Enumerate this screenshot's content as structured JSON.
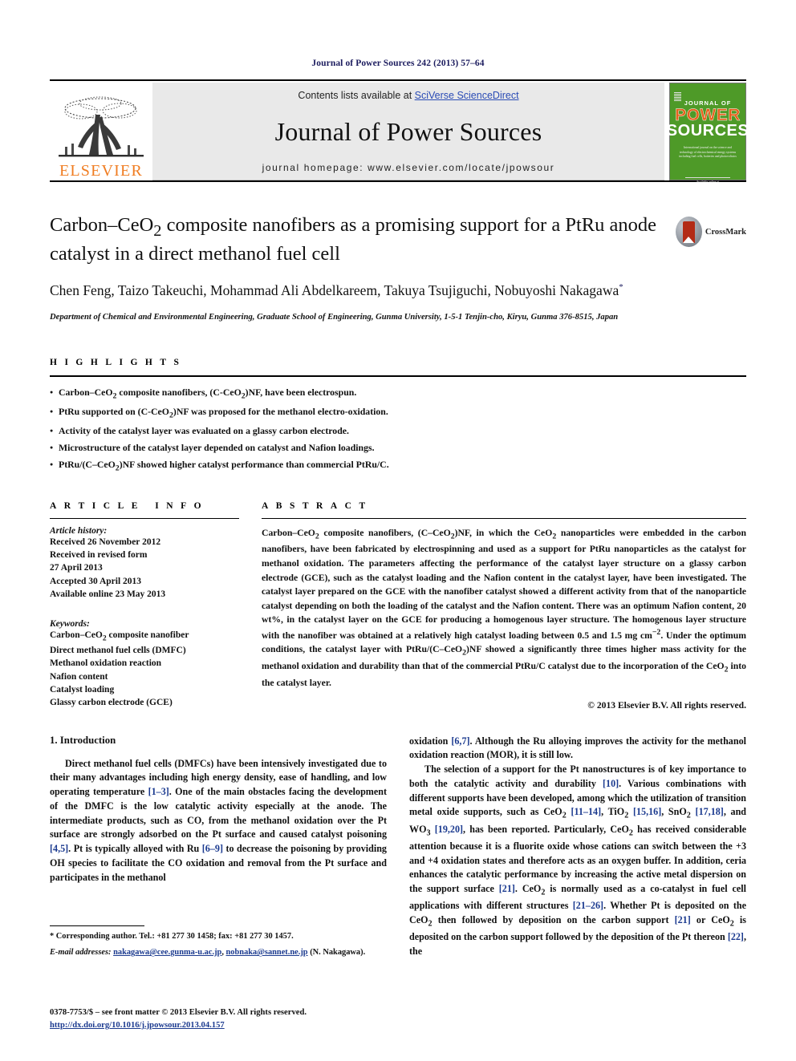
{
  "running_head": "Journal of Power Sources 242 (2013) 57–64",
  "masthead": {
    "elsevier_wordmark": "ELSEVIER",
    "contents_prefix": "Contents lists available at ",
    "contents_link": "SciVerse ScienceDirect",
    "journal_name": "Journal of Power Sources",
    "homepage": "journal homepage: www.elsevier.com/locate/jpowsour",
    "cover": {
      "line1": "JOURNAL OF",
      "line2": "POWER",
      "line3": "SOURCES",
      "blurb": "International journal on the science and technology of electrochemical energy systems including fuel cells, batteries and photovoltaics",
      "footer": "Available online at"
    }
  },
  "article": {
    "title": "Carbon–CeO2 composite nanofibers as a promising support for a PtRu anode catalyst in a direct methanol fuel cell",
    "title_part1": "Carbon–CeO",
    "title_sub": "2",
    "title_part2": " composite nanofibers as a promising support for a PtRu anode catalyst in a direct methanol fuel cell",
    "crossmark_label": "CrossMark",
    "authors": "Chen Feng, Taizo Takeuchi, Mohammad Ali Abdelkareem, Takuya Tsujiguchi, Nobuyoshi Nakagawa",
    "author_marker": "*",
    "affiliation": "Department of Chemical and Environmental Engineering, Graduate School of Engineering, Gunma University, 1-5-1 Tenjin-cho, Kiryu, Gunma 376-8515, Japan"
  },
  "highlights": {
    "label": "HIGHLIGHTS",
    "items": [
      "Carbon–CeO2 composite nanofibers, (C-CeO2)NF, have been electrospun.",
      "PtRu supported on (C-CeO2)NF was proposed for the methanol electro-oxidation.",
      "Activity of the catalyst layer was evaluated on a glassy carbon electrode.",
      "Microstructure of the catalyst layer depended on catalyst and Nafion loadings.",
      "PtRu/(C–CeO2)NF showed higher catalyst performance than commercial PtRu/C."
    ]
  },
  "article_info": {
    "label": "ARTICLE INFO",
    "history_label": "Article history:",
    "history": [
      "Received 26 November 2012",
      "Received in revised form",
      "27 April 2013",
      "Accepted 30 April 2013",
      "Available online 23 May 2013"
    ],
    "keywords_label": "Keywords:",
    "keywords": [
      "Carbon–CeO2 composite nanofiber",
      "Direct methanol fuel cells (DMFC)",
      "Methanol oxidation reaction",
      "Nafion content",
      "Catalyst loading",
      "Glassy carbon electrode (GCE)"
    ]
  },
  "abstract": {
    "label": "ABSTRACT",
    "text": "Carbon–CeO2 composite nanofibers, (C–CeO2)NF, in which the CeO2 nanoparticles were embedded in the carbon nanofibers, have been fabricated by electrospinning and used as a support for PtRu nanoparticles as the catalyst for methanol oxidation. The parameters affecting the performance of the catalyst layer structure on a glassy carbon electrode (GCE), such as the catalyst loading and the Nafion content in the catalyst layer, have been investigated. The catalyst layer prepared on the GCE with the nanofiber catalyst showed a different activity from that of the nanoparticle catalyst depending on both the loading of the catalyst and the Nafion content. There was an optimum Nafion content, 20 wt%, in the catalyst layer on the GCE for producing a homogenous layer structure. The homogenous layer structure with the nanofiber was obtained at a relatively high catalyst loading between 0.5 and 1.5 mg cm−2. Under the optimum conditions, the catalyst layer with PtRu/(C–CeO2)NF showed a significantly three times higher mass activity for the methanol oxidation and durability than that of the commercial PtRu/C catalyst due to the incorporation of the CeO2 into the catalyst layer.",
    "copyright": "© 2013 Elsevier B.V. All rights reserved."
  },
  "body": {
    "section_number_title": "1. Introduction",
    "left_paragraph_1": "Direct methanol fuel cells (DMFCs) have been intensively investigated due to their many advantages including high energy density, ease of handling, and low operating temperature [1–3]. One of the main obstacles facing the development of the DMFC is the low catalytic activity especially at the anode. The intermediate products, such as CO, from the methanol oxidation over the Pt surface are strongly adsorbed on the Pt surface and caused catalyst poisoning [4,5]. Pt is typically alloyed with Ru [6–9] to decrease the poisoning by providing OH species to facilitate the CO oxidation and removal from the Pt surface and participates in the methanol",
    "right_paragraph_1": "oxidation [6,7]. Although the Ru alloying improves the activity for the methanol oxidation reaction (MOR), it is still low.",
    "right_paragraph_2": "The selection of a support for the Pt nanostructures is of key importance to both the catalytic activity and durability [10]. Various combinations with different supports have been developed, among which the utilization of transition metal oxide supports, such as CeO2 [11–14], TiO2 [15,16], SnO2 [17,18], and WO3 [19,20], has been reported. Particularly, CeO2 has received considerable attention because it is a fluorite oxide whose cations can switch between the +3 and +4 oxidation states and therefore acts as an oxygen buffer. In addition, ceria enhances the catalytic performance by increasing the active metal dispersion on the support surface [21]. CeO2 is normally used as a co-catalyst in fuel cell applications with different structures [21–26]. Whether Pt is deposited on the CeO2 then followed by deposition on the carbon support [21] or CeO2 is deposited on the carbon support followed by the deposition of the Pt thereon [22], the"
  },
  "footnote": {
    "corresponding": "* Corresponding author. Tel.: +81 277 30 1458; fax: +81 277 30 1457.",
    "email_label": "E-mail addresses:",
    "email1": "nakagawa@cee.gunma-u.ac.jp",
    "email2": "nobnaka@sannet.ne.jp",
    "email_suffix": "(N. Nakagawa)."
  },
  "footer": {
    "issn_line": "0378-7753/$ – see front matter © 2013 Elsevier B.V. All rights reserved.",
    "doi": "http://dx.doi.org/10.1016/j.jpowsour.2013.04.157"
  },
  "colors": {
    "link_blue": "#1b3a8f",
    "elsevier_orange": "#F07D22",
    "cover_green": "#4e9a28",
    "sciencedirect_blue": "#2a4bb5"
  }
}
